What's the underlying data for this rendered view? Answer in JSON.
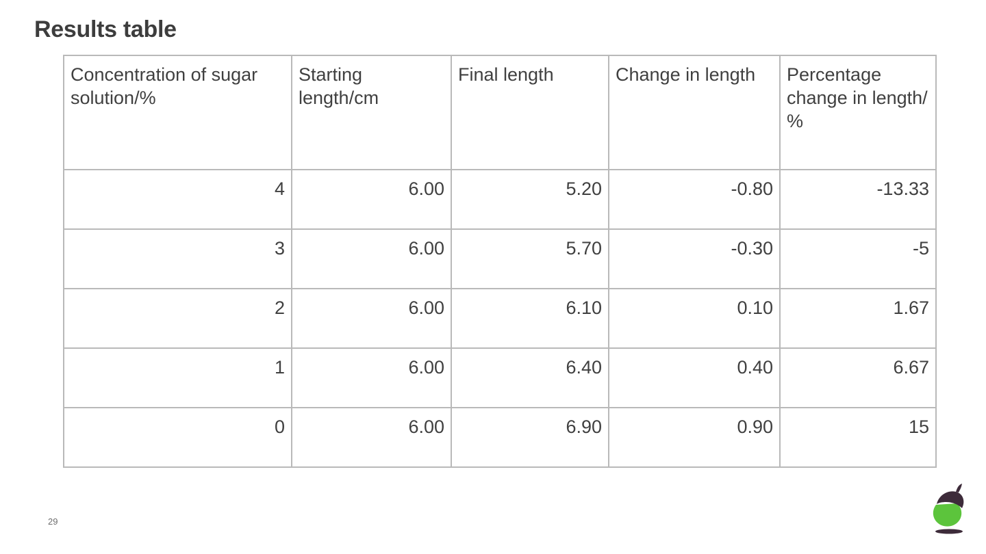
{
  "slide": {
    "title": "Results table",
    "page_number": "29"
  },
  "logo": {
    "name": "acorn-logo",
    "nut_color": "#5cc43c",
    "cap_color": "#3d2b3a",
    "shadow_color": "#3d2b3a"
  },
  "colors": {
    "title_text": "#3d3d3d",
    "table_text": "#404040",
    "table_border": "#b9b9b9",
    "page_number_text": "#6d6d6d",
    "background": "#ffffff"
  },
  "chart_data": {
    "type": "table",
    "title": "Results table",
    "columns": [
      "Concentration of sugar solution/%",
      "Starting length/cm",
      "Final length",
      "Change in length",
      "Percentage change in length/ %"
    ],
    "rows": [
      [
        "4",
        "6.00",
        "5.20",
        "-0.80",
        "-13.33"
      ],
      [
        "3",
        "6.00",
        "5.70",
        "-0.30",
        "-5"
      ],
      [
        "2",
        "6.00",
        "6.10",
        "0.10",
        "1.67"
      ],
      [
        "1",
        "6.00",
        "6.40",
        "0.40",
        "6.67"
      ],
      [
        "0",
        "6.00",
        "6.90",
        "0.90",
        "15"
      ]
    ],
    "series": [
      {
        "name": "Concentration of sugar solution/%",
        "values": [
          4,
          3,
          2,
          1,
          0
        ]
      },
      {
        "name": "Starting length/cm",
        "values": [
          6.0,
          6.0,
          6.0,
          6.0,
          6.0
        ]
      },
      {
        "name": "Final length",
        "values": [
          5.2,
          5.7,
          6.1,
          6.4,
          6.9
        ]
      },
      {
        "name": "Change in length",
        "values": [
          -0.8,
          -0.3,
          0.1,
          0.4,
          0.9
        ]
      },
      {
        "name": "Percentage change in length/ %",
        "values": [
          -13.33,
          -5,
          1.67,
          6.67,
          15
        ]
      }
    ]
  }
}
